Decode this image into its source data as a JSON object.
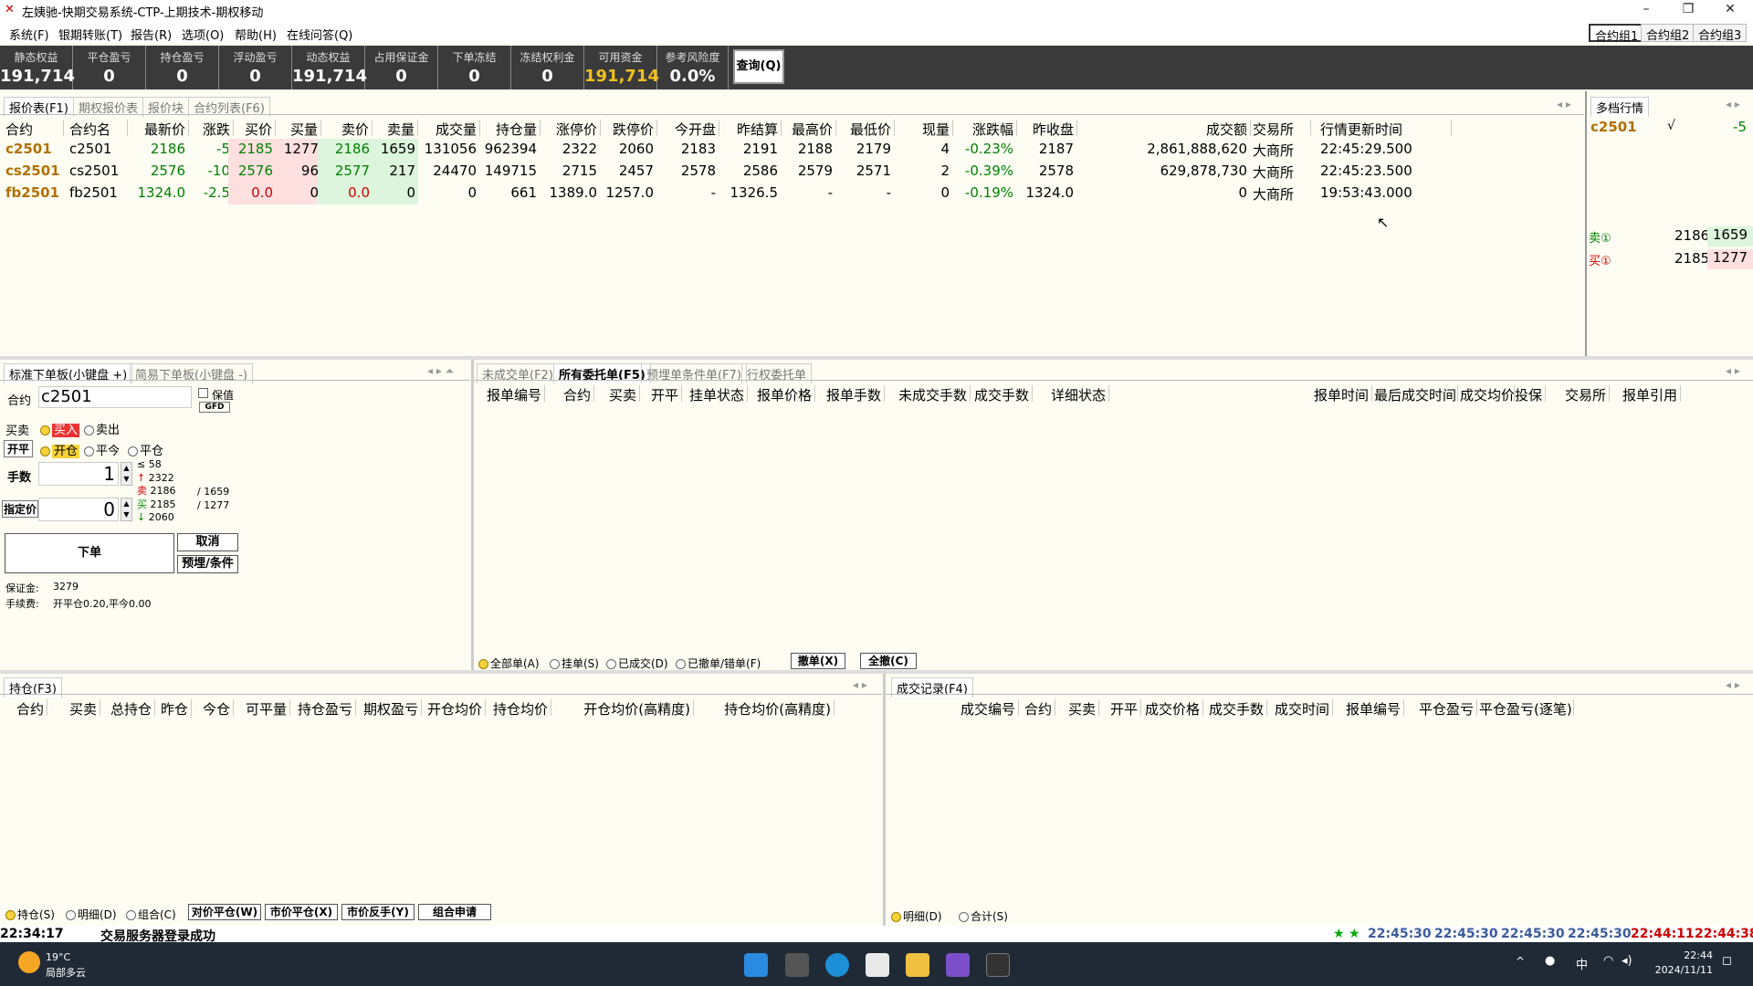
{
  "app": {
    "title": "左姨驰-快期交易系统-CTP-上期技术-期权移动",
    "menus": [
      "系统(F)",
      "银期转账(T)",
      "报告(R)",
      "选项(O)",
      "帮助(H)",
      "在线问答(Q)"
    ],
    "groups": [
      "合约组1",
      "合约组2",
      "合约组3"
    ]
  },
  "stats": [
    {
      "label": "静态权益",
      "value": "191,714"
    },
    {
      "label": "平仓盈亏",
      "value": "0"
    },
    {
      "label": "持仓盈亏",
      "value": "0"
    },
    {
      "label": "浮动盈亏",
      "value": "0"
    },
    {
      "label": "动态权益",
      "value": "191,714"
    },
    {
      "label": "占用保证金",
      "value": "0"
    },
    {
      "label": "下单冻结",
      "value": "0"
    },
    {
      "label": "冻结权利金",
      "value": "0"
    },
    {
      "label": "可用资金",
      "value": "191,714"
    },
    {
      "label": "参考风险度",
      "value": "0.0%"
    }
  ],
  "query_label": "查询(Q)",
  "quote_tabs": [
    "报价表(F1)",
    "期权报价表",
    "报价块",
    "合约列表(F6)"
  ],
  "quote_headers": [
    "合约",
    "合约名",
    "最新价",
    "涨跌",
    "买价",
    "买量",
    "卖价",
    "卖量",
    "成交量",
    "持仓量",
    "涨停价",
    "跌停价",
    "今开盘",
    "昨结算",
    "最高价",
    "最低价",
    "现量",
    "涨跌幅",
    "昨收盘",
    "成交额",
    "交易所",
    "行情更新时间"
  ],
  "quotes": [
    [
      "c2501",
      "c2501",
      "2186",
      "-5",
      "2185",
      "1277",
      "2186",
      "1659",
      "131056",
      "962394",
      "2322",
      "2060",
      "2183",
      "2191",
      "2188",
      "2179",
      "4",
      "-0.23%",
      "2187",
      "2,861,888,620",
      "大商所",
      "22:45:29.500"
    ],
    [
      "cs2501",
      "cs2501",
      "2576",
      "-10",
      "2576",
      "96",
      "2577",
      "217",
      "24470",
      "149715",
      "2715",
      "2457",
      "2578",
      "2586",
      "2579",
      "2571",
      "2",
      "-0.39%",
      "2578",
      "629,878,730",
      "大商所",
      "22:45:23.500"
    ],
    [
      "fb2501",
      "fb2501",
      "1324.0",
      "-2.5",
      "0.0",
      "0",
      "0.0",
      "0",
      "0",
      "661",
      "1389.0",
      "1257.0",
      "-",
      "1326.5",
      "-",
      "-",
      "0",
      "-0.19%",
      "1324.0",
      "0",
      "大商所",
      "19:53:43.000"
    ]
  ],
  "depth": {
    "tab": "多档行情",
    "contract": "c2501",
    "check": "√",
    "change": "-5",
    "sell_label": "卖①",
    "sell_price": "2186",
    "sell_vol": "1659",
    "buy_label": "买①",
    "buy_price": "2185",
    "buy_vol": "1277"
  },
  "order_tabs": [
    "标准下单板(小键盘 +)",
    "简易下单板(小键盘 -)"
  ],
  "order": {
    "contract_label": "合约",
    "contract": "c2501",
    "keep_label": "保值",
    "gfd": "GFD",
    "bs_label": "买卖",
    "buy": "买入",
    "sell": "卖出",
    "oc_label": "开平",
    "open": "开仓",
    "close_today": "平今",
    "close": "平仓",
    "qty_label": "手数",
    "qty": "1",
    "price_label": "指定价",
    "price": "0",
    "limit_max": "58",
    "up_limit": "2322",
    "ask": "2186",
    "ask_vol": "/ 1659",
    "bid": "2185",
    "bid_vol": "/ 1277",
    "down_limit": "2060",
    "submit": "下单",
    "cancel": "取消",
    "preset": "预埋/条件",
    "margin_label": "保证金:",
    "margin": "3279",
    "fee_label": "手续费:",
    "fee": "开平仓0.20,平今0.00"
  },
  "orders_tabs": [
    "未成交单(F2)",
    "所有委托单(F5)",
    "预埋单条件单(F7)",
    "行权委托单"
  ],
  "orders_headers": [
    "报单编号",
    "合约",
    "买卖",
    "开平",
    "挂单状态",
    "报单价格",
    "报单手数",
    "未成交手数",
    "成交手数",
    "详细状态",
    "报单时间",
    "最后成交时间",
    "成交均价",
    "投保",
    "交易所",
    "报单引用"
  ],
  "orders_filters": [
    "全部单(A)",
    "挂单(S)",
    "已成交(D)",
    "已撤单/错单(F)"
  ],
  "orders_btns": [
    "撤单(X)",
    "全撤(C)"
  ],
  "pos_tab": "持仓(F3)",
  "pos_headers": [
    "合约",
    "买卖",
    "总持仓",
    "昨仓",
    "今仓",
    "可平量",
    "持仓盈亏",
    "期权盈亏",
    "开仓均价",
    "持仓均价",
    "开仓均价(高精度)",
    "持仓均价(高精度)"
  ],
  "pos_filters": [
    "持仓(S)",
    "明细(D)",
    "组合(C)"
  ],
  "pos_btns": [
    "对价平仓(W)",
    "市价平仓(X)",
    "市价反手(Y)",
    "组合申请"
  ],
  "trade_tab": "成交记录(F4)",
  "trade_headers": [
    "成交编号",
    "合约",
    "买卖",
    "开平",
    "成交价格",
    "成交手数",
    "成交时间",
    "报单编号",
    "平仓盈亏",
    "平仓盈亏(逐笔)"
  ],
  "trade_filters": [
    "明细(D)",
    "合计(S)"
  ],
  "status": {
    "time": "22:34:17",
    "msg": "交易服务器登录成功",
    "times": [
      "22:45:30",
      "22:45:30",
      "22:45:30",
      "22:45:30",
      "22:44:11",
      "22:44:38"
    ]
  },
  "taskbar": {
    "temp": "19°C",
    "weather": "局部多云",
    "time": "22:44",
    "date": "2024/11/11",
    "ime": "中"
  },
  "colors": {
    "up": "#d00000",
    "down": "#008000",
    "yellow": "#f0c020"
  }
}
